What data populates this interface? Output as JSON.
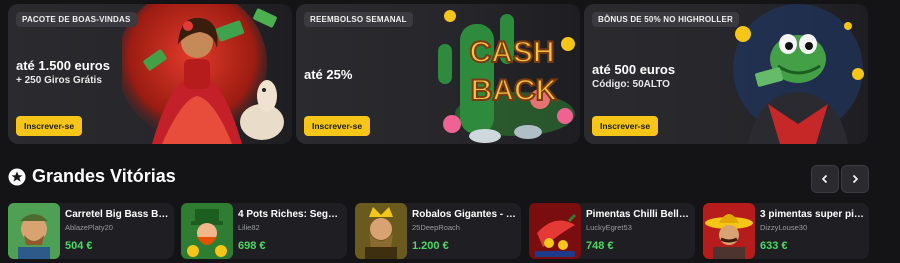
{
  "promos": [
    {
      "badge": "PACOTE DE BOAS-VINDAS",
      "headline": "até 1.500 euros",
      "sub": "+ 250 Giros Grátis",
      "cta": "Inscrever-se"
    },
    {
      "badge": "REEMBOLSO SEMANAL",
      "headline": "até 25%",
      "cta": "Inscrever-se",
      "art_text_1": "CASH",
      "art_text_2": "BACK"
    },
    {
      "badge": "BÔNUS DE 50% NO HIGHROLLER",
      "headline": "até 500 euros",
      "sub": "Código: 50ALTO",
      "cta": "Inscrever-se"
    }
  ],
  "section": {
    "title": "Grandes Vitórias"
  },
  "wins": [
    {
      "game": "Carretel Big Bass Bo...",
      "user": "AblazePlaty20",
      "amount": "504 €"
    },
    {
      "game": "4 Pots Riches: Segur...",
      "user": "Lilie82",
      "amount": "698 €"
    },
    {
      "game": "Robalos Gigantes - S...",
      "user": "25DeepRoach",
      "amount": "1.200 €"
    },
    {
      "game": "Pimentas Chilli Bells 1...",
      "user": "LuckyEgret53",
      "amount": "748 €"
    },
    {
      "game": "3 pimentas super pic...",
      "user": "DizzyLouse30",
      "amount": "633 €"
    }
  ],
  "colors": {
    "accent": "#f5c518",
    "win": "#4cd964",
    "background": "#141416",
    "card": "#1f1f23"
  }
}
